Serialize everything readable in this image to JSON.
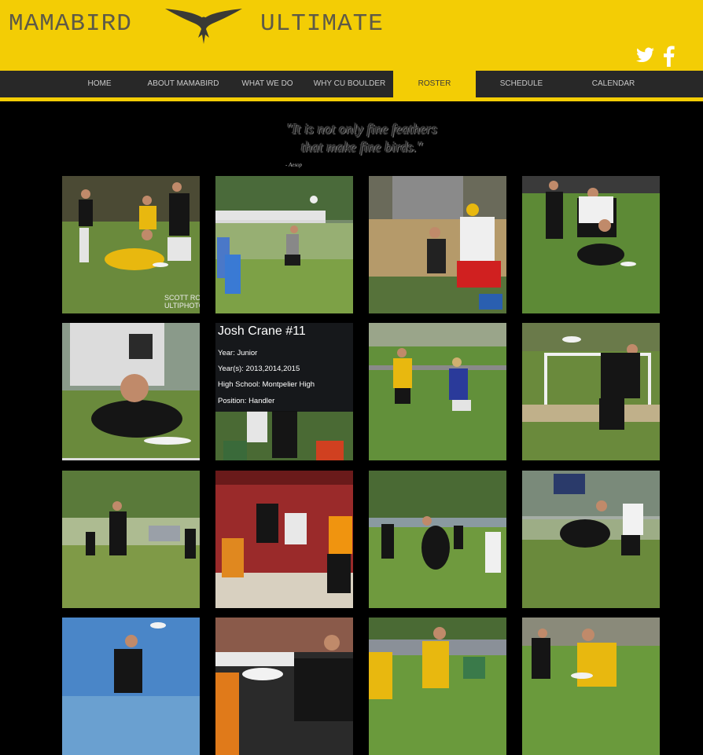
{
  "header": {
    "title_left": "MAMABIRD",
    "title_right": "ULTIMATE",
    "logo_icon": "hawk-logo-icon",
    "brand_color": "#f3cd05",
    "social": [
      {
        "name": "twitter-icon"
      },
      {
        "name": "facebook-icon"
      }
    ]
  },
  "nav": {
    "items": [
      {
        "label": "HOME"
      },
      {
        "label": "ABOUT MAMABIRD"
      },
      {
        "label": "WHAT WE DO"
      },
      {
        "label": "WHY CU BOULDER"
      },
      {
        "label": "ROSTER"
      },
      {
        "label": "SCHEDULE"
      },
      {
        "label": "CALENDAR"
      }
    ],
    "active": "ROSTER"
  },
  "quote": {
    "line1": "\"It is not only fine feathers",
    "line2": "that make fine birds.\"",
    "author": "- Aesop"
  },
  "gallery": {
    "watermark_line1": "SCOTT RO",
    "watermark_line2": "ULTIPHOTO",
    "hovered_player": {
      "name": "Josh Crane #11",
      "year": "Year: Junior",
      "years": "Year(s): 2013,2014,2015",
      "high_school": "High School: Montpelier High",
      "position": "Position: Handler"
    }
  }
}
